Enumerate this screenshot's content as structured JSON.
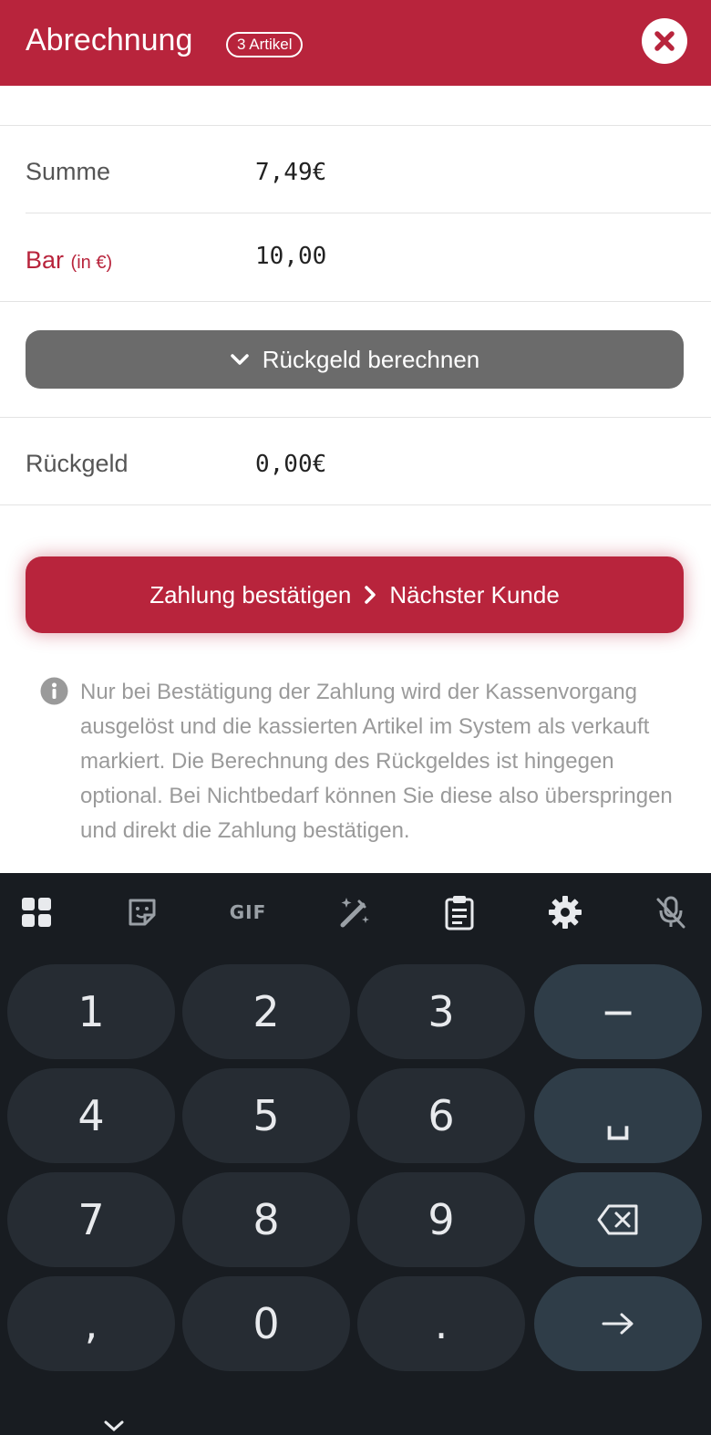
{
  "header": {
    "title": "Abrechnung",
    "badge": "3 Artikel",
    "close_icon": "close-circle-icon",
    "color": "#b8243c"
  },
  "summary": {
    "sum_label": "Summe",
    "sum_value": "7,49€",
    "cash_label": "Bar",
    "cash_unit": "(in  €)",
    "cash_value": "10,00",
    "calc_button": "Rückgeld berechnen",
    "change_label": "Rückgeld",
    "change_value": "0,00€"
  },
  "confirm": {
    "left_label": "Zahlung bestätigen",
    "right_label": "Nächster Kunde"
  },
  "info": {
    "icon": "info-icon",
    "text": "Nur bei Bestätigung der Zahlung wird der Kassenvorgang ausgelöst und die kassierten Artikel im System als verkauft markiert. Die Berechnung des Rückgeldes ist hingegen optional. Bei Nichtbedarf können Sie diese also überspringen und direkt die Zahlung bestätigen."
  },
  "keyboard": {
    "toolbar": [
      "apps-grid-icon",
      "sticker-icon",
      "gif-icon",
      "magic-pen-icon",
      "clipboard-icon",
      "settings-icon",
      "mic-off-icon"
    ],
    "gif_label": "GIF",
    "keys": {
      "k1": "1",
      "k2": "2",
      "k3": "3",
      "minus": "−",
      "k4": "4",
      "k5": "5",
      "k6": "6",
      "space": "␣",
      "k7": "7",
      "k8": "8",
      "k9": "9",
      "comma": ",",
      "k0": "0",
      "period": "."
    },
    "backspace_icon": "backspace-icon",
    "enter_icon": "arrow-right-icon"
  }
}
